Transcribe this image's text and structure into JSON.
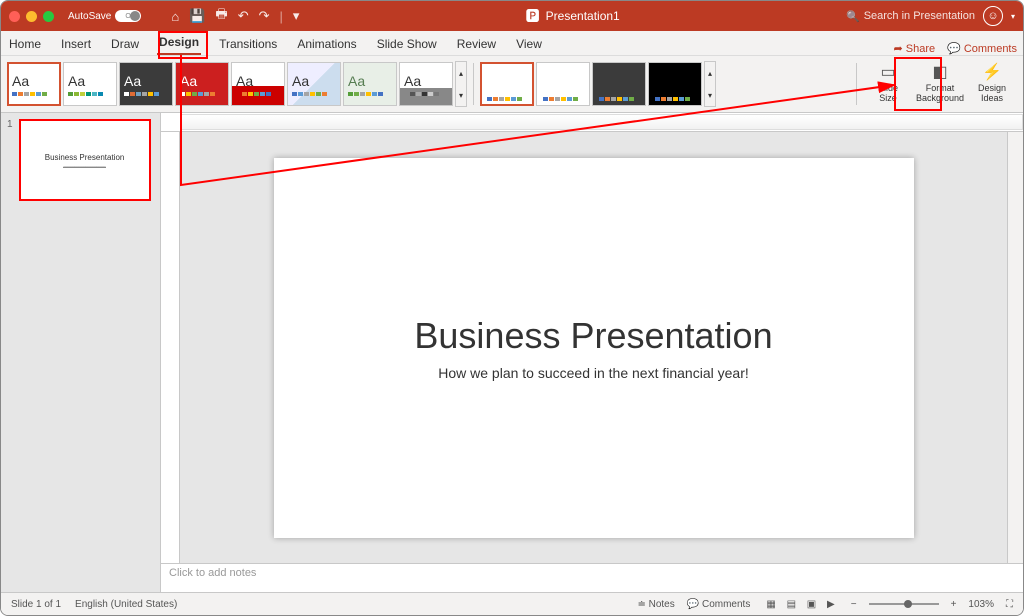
{
  "window_title": "Presentation1",
  "titlebar": {
    "autosave_label": "AutoSave",
    "autosave_state": "OFF",
    "search_placeholder": "Search in Presentation"
  },
  "ribbon_tabs": [
    "Home",
    "Insert",
    "Draw",
    "Design",
    "Transitions",
    "Animations",
    "Slide Show",
    "Review",
    "View"
  ],
  "active_tab": "Design",
  "ribbon_right": {
    "share": "Share",
    "comments": "Comments"
  },
  "themes": {
    "sample_text": "Aa"
  },
  "ribbon_buttons": {
    "slide_size": "Slide\nSize",
    "format_bg": "Format\nBackground",
    "design_ideas": "Design\nIdeas"
  },
  "slide": {
    "title": "Business Presentation",
    "subtitle": "How we plan to succeed in the next financial year!"
  },
  "thumb": {
    "number": "1"
  },
  "notes_placeholder": "Click to add notes",
  "status": {
    "slide_counter": "Slide 1 of 1",
    "language": "English (United States)",
    "notes_btn": "Notes",
    "comments_btn": "Comments",
    "zoom_pct": "103%"
  }
}
